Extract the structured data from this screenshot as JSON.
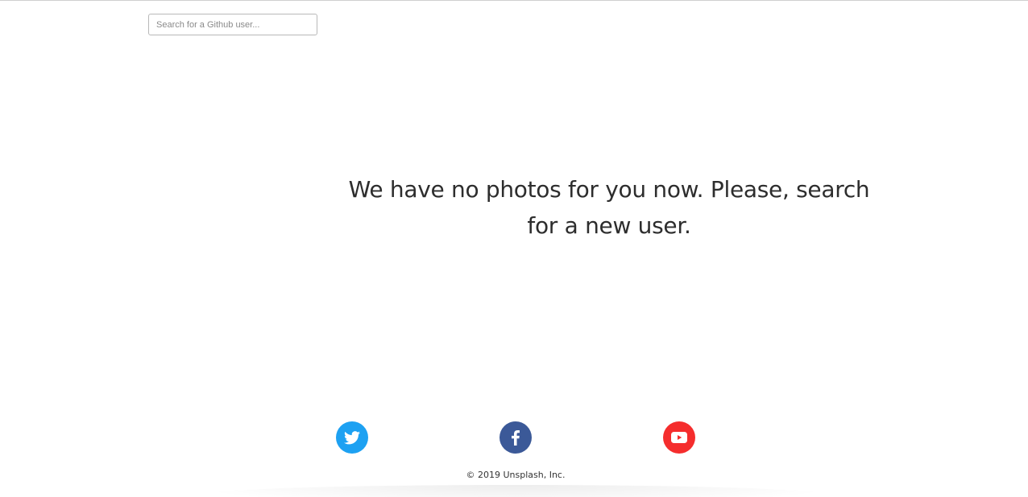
{
  "search": {
    "placeholder": "Search for a Github user...",
    "value": ""
  },
  "main": {
    "empty_message": "We have no photos for you now. Please, search for a new user."
  },
  "footer": {
    "social": [
      {
        "icon": "twitter-icon",
        "color": "#1da1f2"
      },
      {
        "icon": "facebook-icon",
        "color": "#3b5998"
      },
      {
        "icon": "youtube-icon",
        "color": "#f52d2d"
      }
    ],
    "copyright": "© 2019 Unsplash, Inc."
  }
}
